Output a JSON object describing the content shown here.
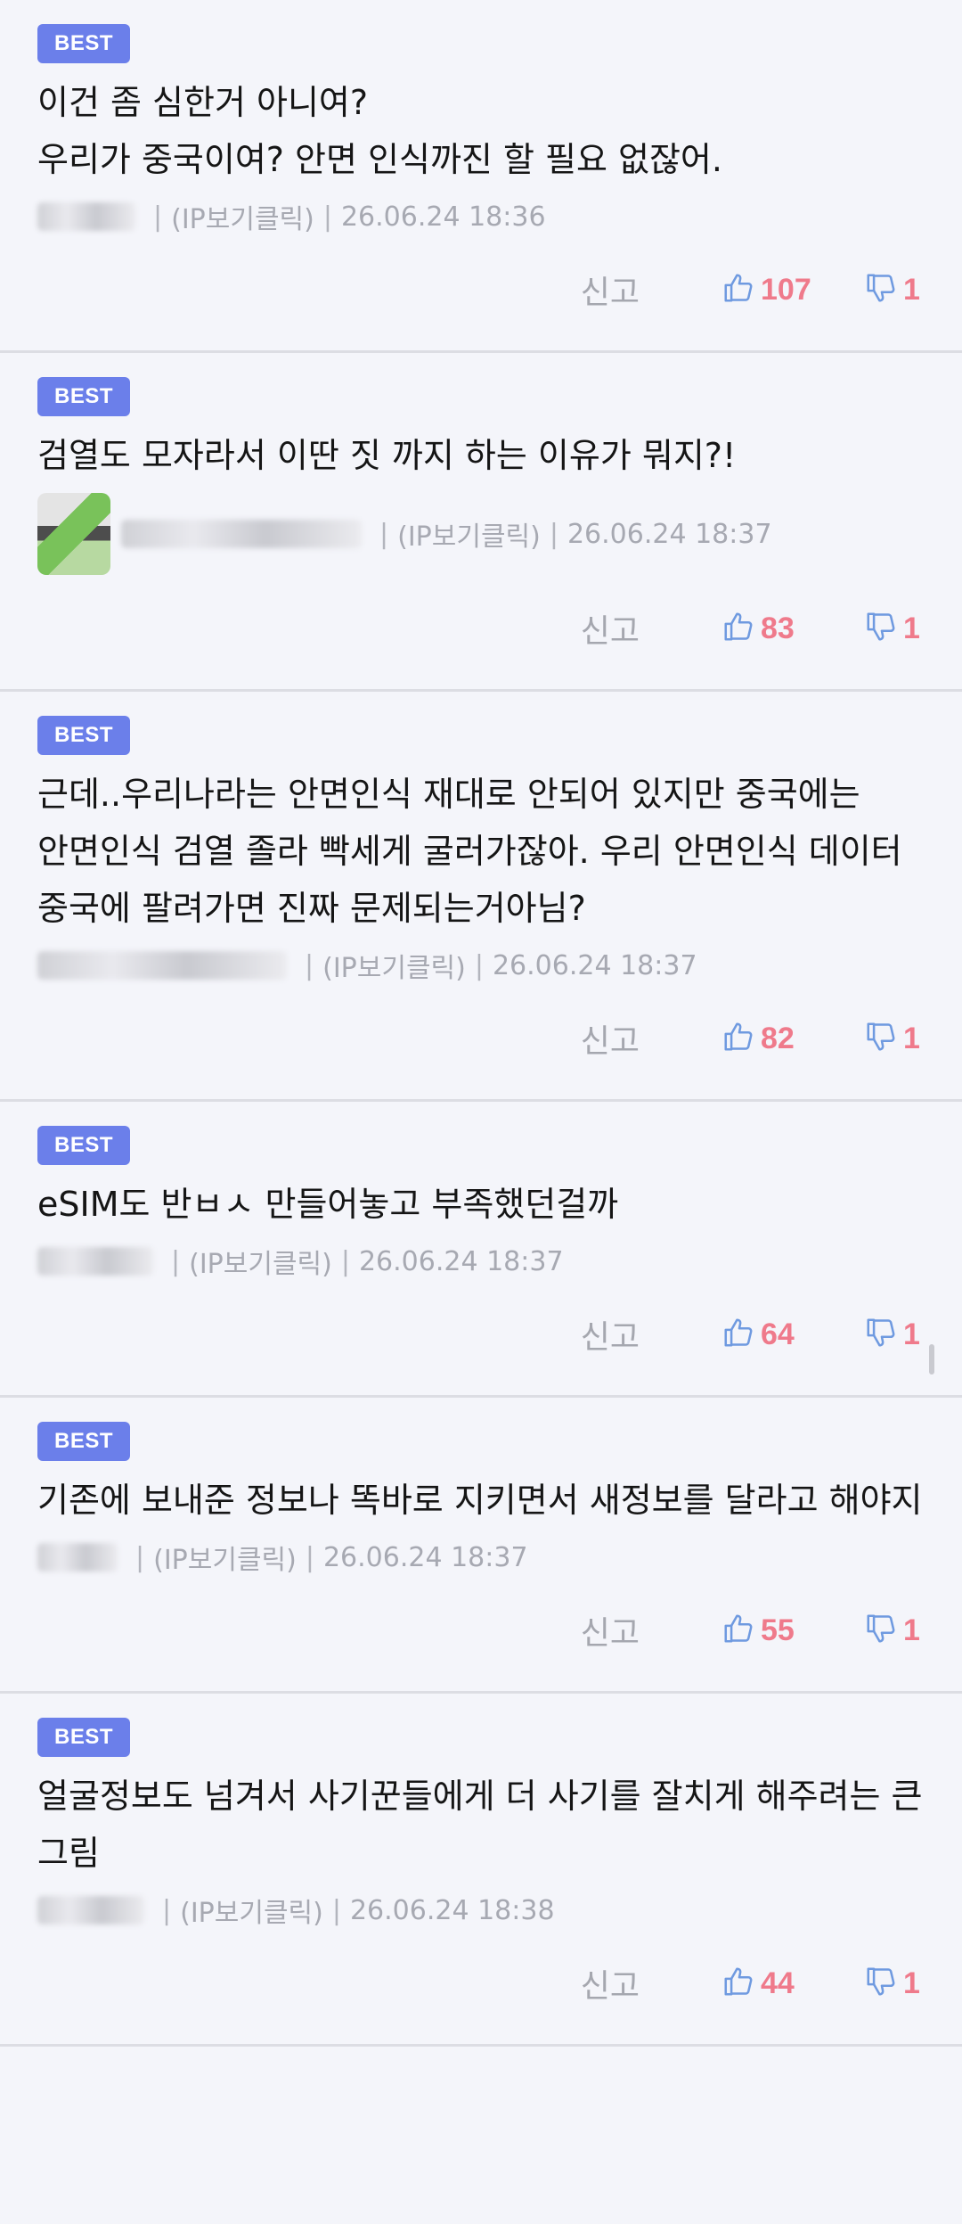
{
  "comments": [
    {
      "badge": "BEST",
      "text": "이건 좀 심한거 아니여?\n우리가 중국이여? 안면 인식까진 할 필요 없잖어.",
      "ip_label": "(IP보기클릭)",
      "date": "26.06.24 18:36",
      "report": "신고",
      "likes": "107",
      "dislikes": "1",
      "has_avatar": false,
      "nick_width": 110
    },
    {
      "badge": "BEST",
      "text": "검열도 모자라서 이딴 짓 까지 하는 이유가 뭐지?!",
      "ip_label": "(IP보기클릭)",
      "date": "26.06.24 18:37",
      "report": "신고",
      "likes": "83",
      "dislikes": "1",
      "has_avatar": true,
      "nick_width": 270
    },
    {
      "badge": "BEST",
      "text": "근데..우리나라는 안면인식 재대로 안되어 있지만 중국에는 안면인식 검열 졸라 빡세게 굴러가잖아. 우리 안면인식 데이터 중국에 팔려가면 진짜 문제되는거아님?",
      "ip_label": "(IP보기클릭)",
      "date": "26.06.24 18:37",
      "report": "신고",
      "likes": "82",
      "dislikes": "1",
      "has_avatar": false,
      "nick_width": 280
    },
    {
      "badge": "BEST",
      "text": "eSIM도 반ㅂㅅ 만들어놓고 부족했던걸까",
      "ip_label": "(IP보기클릭)",
      "date": "26.06.24 18:37",
      "report": "신고",
      "likes": "64",
      "dislikes": "1",
      "has_avatar": false,
      "nick_width": 130
    },
    {
      "badge": "BEST",
      "text": "기존에 보내준 정보나 똑바로 지키면서 새정보를 달라고 해야지",
      "ip_label": "(IP보기클릭)",
      "date": "26.06.24 18:37",
      "report": "신고",
      "likes": "55",
      "dislikes": "1",
      "has_avatar": false,
      "nick_width": 90
    },
    {
      "badge": "BEST",
      "text": "얼굴정보도 넘겨서 사기꾼들에게 더 사기를 잘치게 해주려는 큰 그림",
      "ip_label": "(IP보기클릭)",
      "date": "26.06.24 18:38",
      "report": "신고",
      "likes": "44",
      "dislikes": "1",
      "has_avatar": false,
      "nick_width": 120
    }
  ],
  "colors": {
    "badge": "#6b7fea",
    "count": "#ef7a8b",
    "thumb": "#6f9ae0"
  },
  "icons": {
    "like": "thumbs-up-icon",
    "dislike": "thumbs-down-icon"
  }
}
